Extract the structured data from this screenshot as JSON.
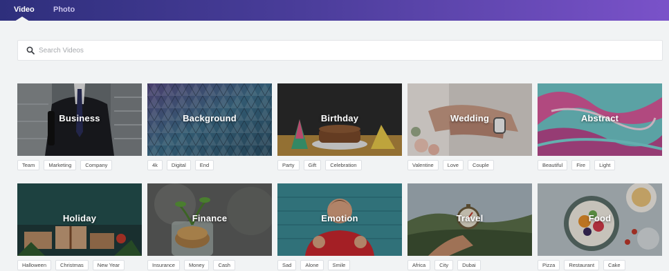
{
  "tabs": [
    {
      "label": "Video",
      "active": true
    },
    {
      "label": "Photo",
      "active": false
    }
  ],
  "search": {
    "placeholder": "Search Videos",
    "icon": "search-icon"
  },
  "categories": [
    {
      "title": "Business",
      "tags": [
        "Team",
        "Marketing",
        "Company"
      ]
    },
    {
      "title": "Background",
      "tags": [
        "4k",
        "Digital",
        "End"
      ]
    },
    {
      "title": "Birthday",
      "tags": [
        "Party",
        "Gift",
        "Celebration"
      ]
    },
    {
      "title": "Wedding",
      "tags": [
        "Valentine",
        "Love",
        "Couple"
      ]
    },
    {
      "title": "Abstract",
      "tags": [
        "Beautiful",
        "Fire",
        "Light"
      ]
    },
    {
      "title": "Holiday",
      "tags": [
        "Halloween",
        "Christmas",
        "New Year"
      ]
    },
    {
      "title": "Finance",
      "tags": [
        "Insurance",
        "Money",
        "Cash"
      ]
    },
    {
      "title": "Emotion",
      "tags": [
        "Sad",
        "Alone",
        "Smile"
      ]
    },
    {
      "title": "Travel",
      "tags": [
        "Africa",
        "City",
        "Dubai"
      ]
    },
    {
      "title": "Food",
      "tags": [
        "Pizza",
        "Restaurant",
        "Cake"
      ]
    }
  ],
  "colors": {
    "header_start": "#2e2f7c",
    "header_end": "#7a52c9",
    "page_bg": "#f1f3f4"
  }
}
